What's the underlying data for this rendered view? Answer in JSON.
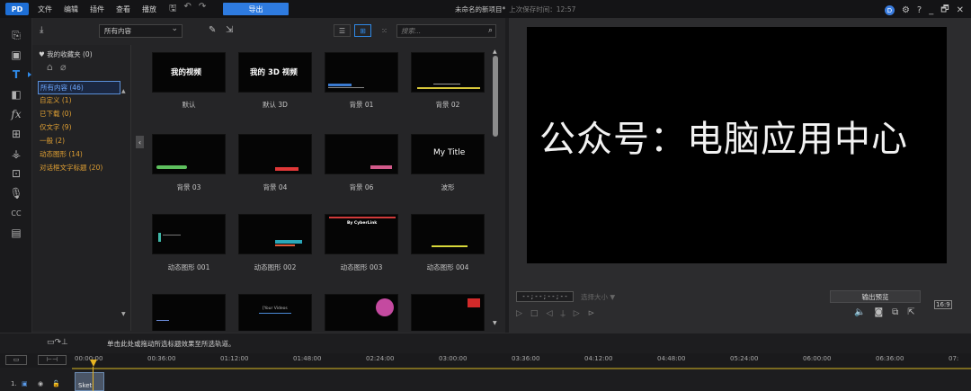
{
  "app": {
    "logo": "PD",
    "menu": [
      "文件",
      "编辑",
      "插件",
      "查看",
      "播放"
    ],
    "export_label": "导出",
    "project_title": "未命名的新项目*",
    "last_saved": "上次保存时间：12:57",
    "window_controls": [
      "D",
      "⚙",
      "?",
      "_",
      "🗗",
      "✕"
    ]
  },
  "library": {
    "content_filter": "所有内容",
    "search_placeholder": "搜索...",
    "favorites": "我的收藏夹 (0)",
    "categories": [
      {
        "label": "所有内容 (46)",
        "selected": true
      },
      {
        "label": "自定义 (1)"
      },
      {
        "label": "已下载 (0)"
      },
      {
        "label": "仅文字 (9)"
      },
      {
        "label": "一般 (2)"
      },
      {
        "label": "动态图形 (14)"
      },
      {
        "label": "对话框文字标题 (20)"
      }
    ],
    "thumbnails": [
      {
        "label": "默认",
        "text": "我的视频"
      },
      {
        "label": "默认 3D",
        "text": "我的 3D 视频"
      },
      {
        "label": "背景 01",
        "text": ""
      },
      {
        "label": "背景 02",
        "text": ""
      },
      {
        "label": "背景 03",
        "text": ""
      },
      {
        "label": "背景 04",
        "text": ""
      },
      {
        "label": "背景 06",
        "text": ""
      },
      {
        "label": "波形",
        "text": "My Title"
      },
      {
        "label": "动态图形 001",
        "text": ""
      },
      {
        "label": "动态图形 002",
        "text": ""
      },
      {
        "label": "动态图形 003",
        "text": "By CyberLink"
      },
      {
        "label": "动态图形 004",
        "text": ""
      },
      {
        "label": "",
        "text": ""
      },
      {
        "label": "",
        "text": "[Your Videos"
      },
      {
        "label": "",
        "text": ""
      },
      {
        "label": "",
        "text": ""
      }
    ]
  },
  "preview": {
    "screen_text": "公众号：电脑应用中心",
    "timecode": "- - ; - - ; - - ; - -",
    "quality": "选择大小 ▼",
    "output_preview": "输出预览",
    "aspect": "16:9"
  },
  "timeline": {
    "hint": "单击此处或拖动所选标题效果至所选轨道。",
    "ticks": [
      "00:00:00",
      "00:36:00",
      "01:12:00",
      "01:48:00",
      "02:24:00",
      "03:00:00",
      "03:36:00",
      "04:12:00",
      "04:48:00",
      "05:24:00",
      "06:00:00",
      "06:36:00",
      "07:"
    ],
    "track_label": "1.",
    "clip_label": "Sket"
  },
  "colors": {
    "accent": "#2e7be0",
    "category": "#e0a033",
    "playhead": "#e6b422"
  }
}
